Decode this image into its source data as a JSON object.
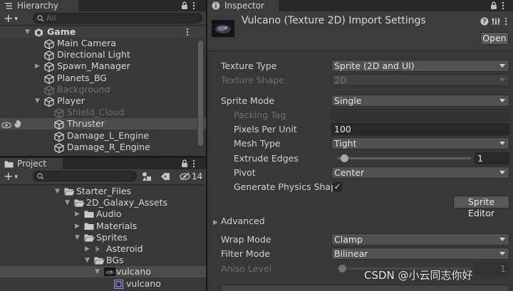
{
  "hierarchy": {
    "tab_label": "Hierarchy",
    "search_placeholder": "All",
    "scene_name": "Game",
    "rows": [
      {
        "label": "Main Camera",
        "icon": "cube-icon",
        "state": "normal"
      },
      {
        "label": "Directional Light",
        "icon": "cube-icon",
        "state": "normal"
      },
      {
        "label": "Spawn_Manager",
        "icon": "cube-icon",
        "state": "collapsed"
      },
      {
        "label": "Planets_BG",
        "icon": "cube-icon",
        "state": "normal"
      },
      {
        "label": "Background",
        "icon": "cube-icon",
        "state": "disabled"
      },
      {
        "label": "Player",
        "icon": "cube-icon",
        "state": "expanded"
      },
      {
        "label": "Shield_Cloud",
        "icon": "cube-icon",
        "state": "disabled"
      },
      {
        "label": "Thruster",
        "icon": "cube-icon",
        "state": "selected"
      },
      {
        "label": "Damage_L_Engine",
        "icon": "cube-icon",
        "state": "normal"
      },
      {
        "label": "Damage_R_Engine",
        "icon": "cube-icon",
        "state": "normal"
      }
    ]
  },
  "project": {
    "tab_label": "Project",
    "hidden_count": "14",
    "tree": [
      {
        "label": "Starter_Files",
        "icon": "folder-open-icon",
        "fold": "expanded"
      },
      {
        "label": "2D_Galaxy_Assets",
        "icon": "folder-open-icon",
        "fold": "expanded"
      },
      {
        "label": "Audio",
        "icon": "folder-icon",
        "fold": "collapsed"
      },
      {
        "label": "Materials",
        "icon": "folder-icon",
        "fold": "collapsed"
      },
      {
        "label": "Sprites",
        "icon": "folder-open-icon",
        "fold": "expanded"
      },
      {
        "label": "Asteroid",
        "icon": "sprite-icon",
        "fold": "collapsed"
      },
      {
        "label": "BGs",
        "icon": "folder-open-icon",
        "fold": "expanded"
      },
      {
        "label": "vulcano",
        "icon": "texture-icon",
        "fold": "expanded"
      },
      {
        "label": "vulcano",
        "icon": "sprite-sub-icon",
        "fold": "none"
      }
    ]
  },
  "inspector": {
    "tab_label": "Inspector",
    "title": "Vulcano (Texture 2D) Import Settings",
    "open_button": "Open",
    "texture_type": {
      "label": "Texture Type",
      "value": "Sprite (2D and UI)"
    },
    "texture_shape": {
      "label": "Texture Shape",
      "value": "2D"
    },
    "sprite_mode": {
      "label": "Sprite Mode",
      "value": "Single"
    },
    "packing_tag": {
      "label": "Packing Tag",
      "value": ""
    },
    "pixels_per_unit": {
      "label": "Pixels Per Unit",
      "value": "100"
    },
    "mesh_type": {
      "label": "Mesh Type",
      "value": "Tight"
    },
    "extrude_edges": {
      "label": "Extrude Edges",
      "value": "1",
      "slider_fraction": 0.03
    },
    "pivot": {
      "label": "Pivot",
      "value": "Center"
    },
    "generate_physics_shape": {
      "label": "Generate Physics Shape",
      "checked": true,
      "check_glyph": "✓"
    },
    "sprite_editor_button": "Sprite Editor",
    "advanced": {
      "label": "Advanced"
    },
    "wrap_mode": {
      "label": "Wrap Mode",
      "value": "Clamp"
    },
    "filter_mode": {
      "label": "Filter Mode",
      "value": "Bilinear"
    },
    "aniso_level": {
      "label": "Aniso Level",
      "value": "1"
    }
  },
  "watermark": "CSDN @小云同志你好",
  "colors": {
    "panel_bg": "#383838",
    "tabbar_bg": "#282828",
    "selection": "#4c4c4c",
    "text": "#d6d6d6",
    "disabled_text": "#6f6f6f"
  }
}
